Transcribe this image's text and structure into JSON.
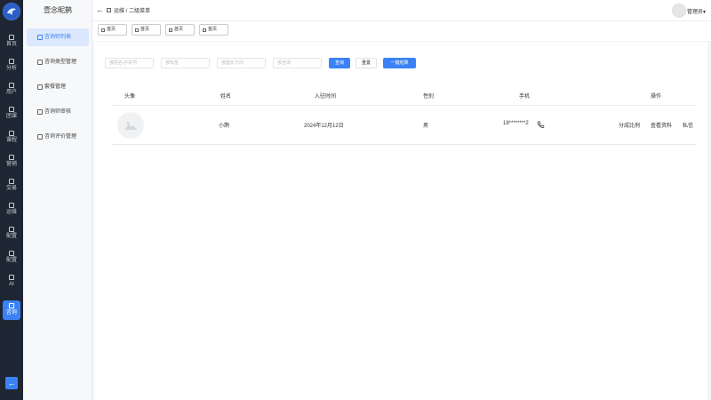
{
  "rail": {
    "items": [
      {
        "label": "首页"
      },
      {
        "label": "分析"
      },
      {
        "label": "用户"
      },
      {
        "label": "团课"
      },
      {
        "label": "课程"
      },
      {
        "label": "营销"
      },
      {
        "label": "交易"
      },
      {
        "label": "运维"
      },
      {
        "label": "配置"
      },
      {
        "label": "配置"
      },
      {
        "label": "AI"
      },
      {
        "label": "咨询"
      }
    ],
    "back_glyph": "←"
  },
  "sidebar": {
    "title": "壹念昵鹊",
    "items": [
      {
        "label": "咨询师列表"
      },
      {
        "label": "咨询类型管理"
      },
      {
        "label": "套餐管理"
      },
      {
        "label": "咨询师审核"
      },
      {
        "label": "咨询评价管理"
      }
    ]
  },
  "header": {
    "back_glyph": "←",
    "breadcrumb": "运维 / 二级菜单",
    "user": "管理员",
    "dropdown_glyph": "▾"
  },
  "tabs": [
    {
      "label": "首页"
    },
    {
      "label": "首页"
    },
    {
      "label": "首页"
    },
    {
      "label": "首页"
    }
  ],
  "filters": {
    "name_placeholder": "按姓名/手机号",
    "tag_placeholder": "按标签",
    "direction_placeholder": "按擅长方向",
    "consult_placeholder": "按咨询",
    "query_button": "查询",
    "reset_button": "重置",
    "settle_button": "一键结算"
  },
  "table": {
    "headers": {
      "avatar": "头像",
      "name": "姓名",
      "join_time": "入驻时间",
      "gender": "性别",
      "phone": "手机",
      "actions": "操作"
    },
    "rows": [
      {
        "name": "小鹊",
        "join_time": "2024年12月12日",
        "gender": "男",
        "phone": "18********2",
        "action_split": "分成比例",
        "action_profile": "查看资料",
        "action_message": "私信"
      }
    ]
  },
  "colors": {
    "accent": "#3b82f6",
    "rail_bg": "#1f2633",
    "active_side_bg": "#dbe8fd"
  }
}
